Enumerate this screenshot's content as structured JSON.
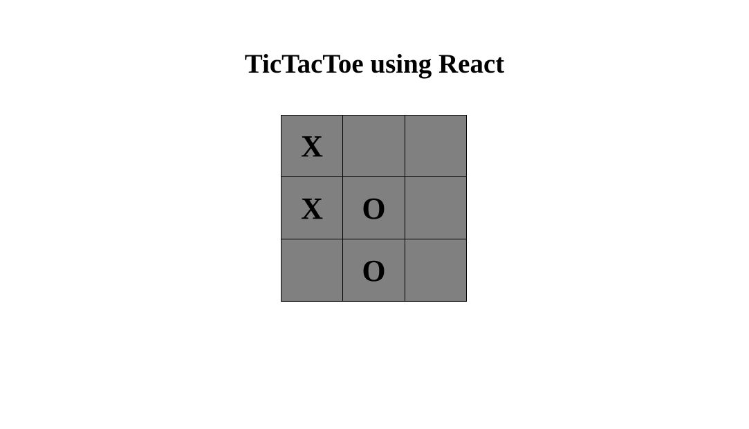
{
  "title": "TicTacToe using React",
  "colors": {
    "background": "#ffffff",
    "cell_fill": "#808080",
    "border": "#000000",
    "text": "#000000"
  },
  "board": {
    "cells": [
      "X",
      "",
      "",
      "X",
      "O",
      "",
      "",
      "O",
      ""
    ]
  }
}
